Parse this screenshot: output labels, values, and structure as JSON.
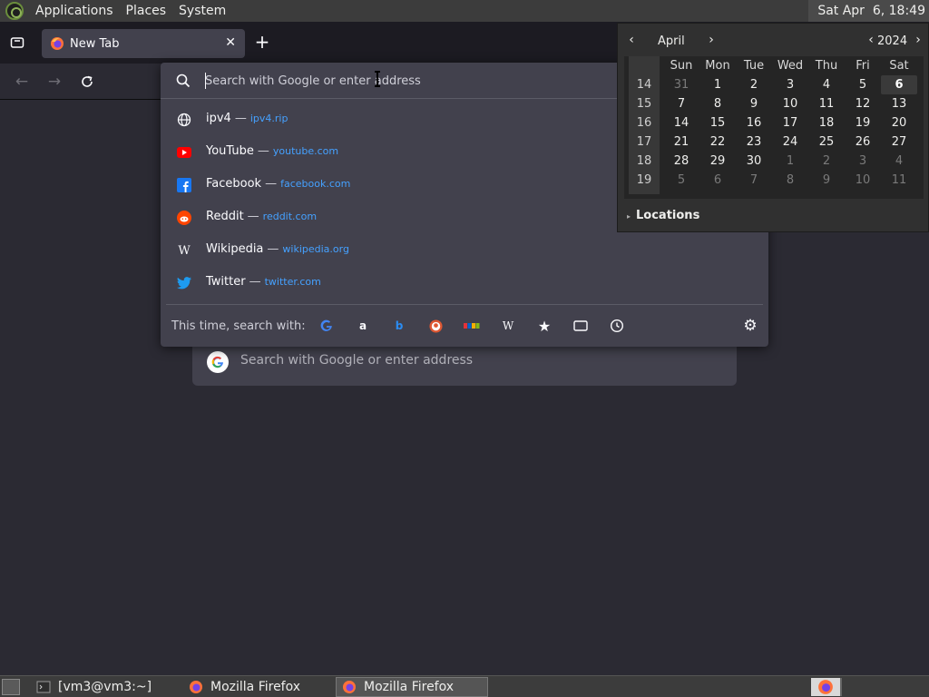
{
  "top_panel": {
    "menus": [
      "Applications",
      "Places",
      "System"
    ],
    "clock": "Sat Apr  6, 18:49"
  },
  "browser": {
    "tab_title": "New Tab",
    "close_glyph": "✕",
    "new_tab_glyph": "+",
    "urlbar_placeholder": "Search with Google or enter address",
    "results": [
      {
        "title": "ipv4",
        "url": "ipv4.rip",
        "icon": "globe-icon"
      },
      {
        "title": "YouTube",
        "url": "youtube.com",
        "icon": "youtube-icon"
      },
      {
        "title": "Facebook",
        "url": "facebook.com",
        "icon": "facebook-icon"
      },
      {
        "title": "Reddit",
        "url": "reddit.com",
        "icon": "reddit-icon"
      },
      {
        "title": "Wikipedia",
        "url": "wikipedia.org",
        "icon": "wikipedia-icon"
      },
      {
        "title": "Twitter",
        "url": "twitter.com",
        "icon": "twitter-icon"
      }
    ],
    "separator": "—",
    "oneoff_label": "This time, search with:",
    "engines": [
      "google-icon",
      "amazon-icon",
      "bing-icon",
      "duckduckgo-icon",
      "ebay-icon",
      "wikipedia-icon",
      "bookmarks-icon",
      "tabs-icon",
      "history-icon"
    ],
    "ntp_search_placeholder": "Search with Google or enter address"
  },
  "calendar": {
    "month": "April",
    "year": "2024",
    "weekday_headers": [
      "Sun",
      "Mon",
      "Tue",
      "Wed",
      "Thu",
      "Fri",
      "Sat"
    ],
    "weeks": [
      {
        "num": "14",
        "days": [
          {
            "d": "31",
            "dim": true
          },
          {
            "d": "1"
          },
          {
            "d": "2"
          },
          {
            "d": "3"
          },
          {
            "d": "4"
          },
          {
            "d": "5"
          },
          {
            "d": "6",
            "today": true
          }
        ]
      },
      {
        "num": "15",
        "days": [
          {
            "d": "7"
          },
          {
            "d": "8"
          },
          {
            "d": "9"
          },
          {
            "d": "10"
          },
          {
            "d": "11"
          },
          {
            "d": "12"
          },
          {
            "d": "13"
          }
        ]
      },
      {
        "num": "16",
        "days": [
          {
            "d": "14"
          },
          {
            "d": "15"
          },
          {
            "d": "16"
          },
          {
            "d": "17"
          },
          {
            "d": "18"
          },
          {
            "d": "19"
          },
          {
            "d": "20"
          }
        ]
      },
      {
        "num": "17",
        "days": [
          {
            "d": "21"
          },
          {
            "d": "22"
          },
          {
            "d": "23"
          },
          {
            "d": "24"
          },
          {
            "d": "25"
          },
          {
            "d": "26"
          },
          {
            "d": "27"
          }
        ]
      },
      {
        "num": "18",
        "days": [
          {
            "d": "28"
          },
          {
            "d": "29"
          },
          {
            "d": "30"
          },
          {
            "d": "1",
            "dim": true
          },
          {
            "d": "2",
            "dim": true
          },
          {
            "d": "3",
            "dim": true
          },
          {
            "d": "4",
            "dim": true
          }
        ]
      },
      {
        "num": "19",
        "days": [
          {
            "d": "5",
            "dim": true
          },
          {
            "d": "6",
            "dim": true
          },
          {
            "d": "7",
            "dim": true
          },
          {
            "d": "8",
            "dim": true
          },
          {
            "d": "9",
            "dim": true
          },
          {
            "d": "10",
            "dim": true
          },
          {
            "d": "11",
            "dim": true
          }
        ]
      }
    ],
    "locations_label": "Locations"
  },
  "taskbar": {
    "tasks": [
      {
        "label": "[vm3@vm3:~]",
        "icon": "terminal-icon",
        "active": false
      },
      {
        "label": "Mozilla Firefox",
        "icon": "firefox-icon",
        "active": false
      },
      {
        "label": "Mozilla Firefox",
        "icon": "firefox-icon",
        "active": true
      }
    ]
  },
  "colors": {
    "url_link": "#45a1ff",
    "popup_bg": "#42414d",
    "page_bg": "#2b2a33"
  }
}
